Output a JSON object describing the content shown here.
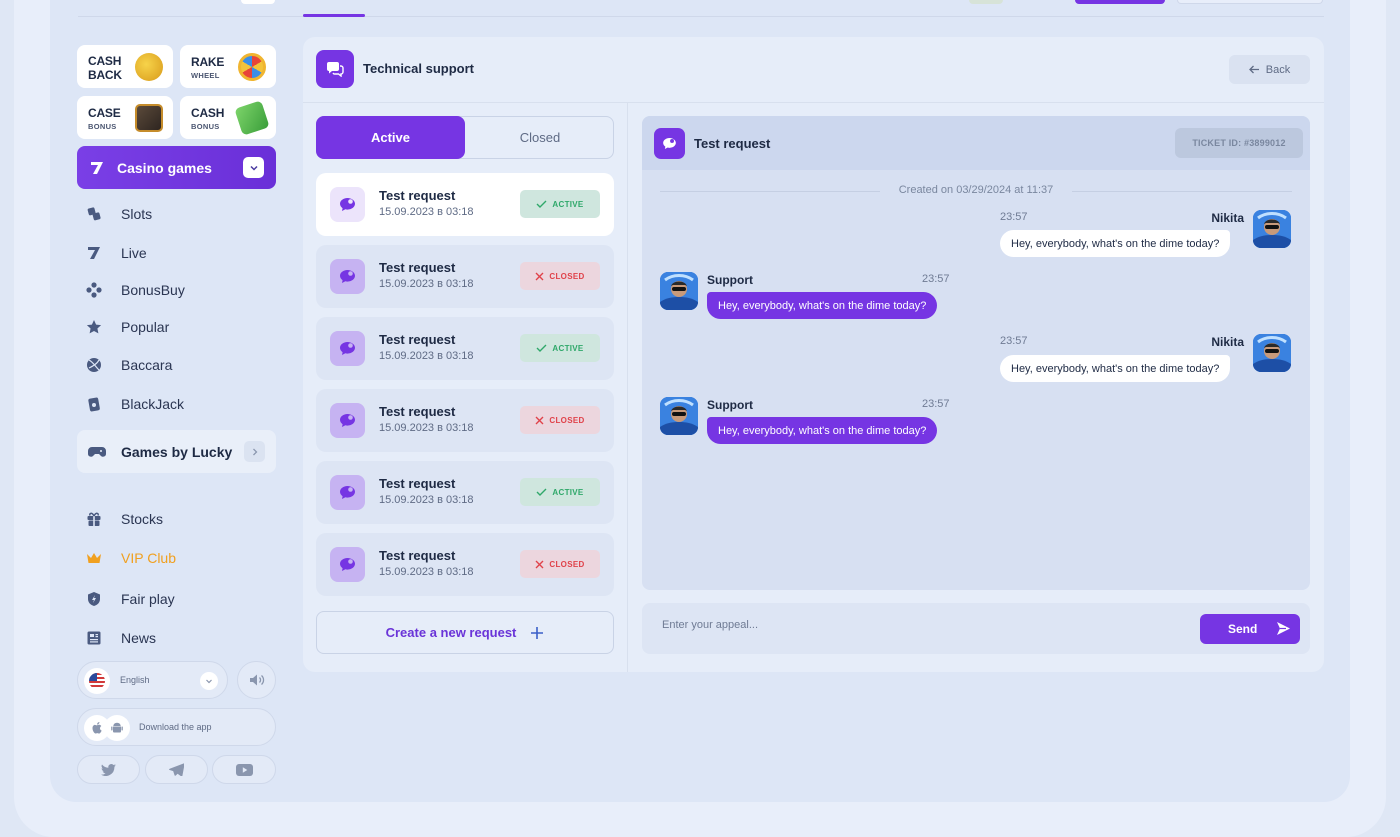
{
  "sidebar": {
    "promos": [
      {
        "title": "CASH",
        "sub": "BACK",
        "icon": "cashback-coin-icon"
      },
      {
        "title": "RAKE",
        "sub": "WHEEL",
        "icon": "wheel-icon"
      },
      {
        "title": "CASE",
        "sub": "BONUS",
        "icon": "safe-icon"
      },
      {
        "title": "CASH",
        "sub": "BONUS",
        "icon": "money-icon"
      }
    ],
    "casino_label": "Casino games",
    "games": [
      {
        "label": "Slots",
        "icon": "slots-icon"
      },
      {
        "label": "Live",
        "icon": "seven-icon"
      },
      {
        "label": "BonusBuy",
        "icon": "dpad-icon"
      },
      {
        "label": "Popular",
        "icon": "star-icon"
      },
      {
        "label": "Baccara",
        "icon": "ball-icon"
      },
      {
        "label": "BlackJack",
        "icon": "cards-icon"
      }
    ],
    "games_by_lucky": "Games by Lucky",
    "links": [
      {
        "label": "Stocks",
        "icon": "gift-icon"
      },
      {
        "label": "VIP Club",
        "icon": "crown-icon"
      },
      {
        "label": "Fair play",
        "icon": "shield-icon"
      },
      {
        "label": "News",
        "icon": "newspaper-icon"
      }
    ],
    "language": "English",
    "download": "Download the app"
  },
  "support": {
    "title": "Technical support",
    "back": "Back",
    "tabs": {
      "active": "Active",
      "closed": "Closed"
    },
    "tickets": [
      {
        "title": "Test request",
        "date": "15.09.2023 в 03:18",
        "status": "ACTIVE"
      },
      {
        "title": "Test request",
        "date": "15.09.2023 в 03:18",
        "status": "CLOSED"
      },
      {
        "title": "Test request",
        "date": "15.09.2023 в 03:18",
        "status": "ACTIVE"
      },
      {
        "title": "Test request",
        "date": "15.09.2023 в 03:18",
        "status": "CLOSED"
      },
      {
        "title": "Test request",
        "date": "15.09.2023 в 03:18",
        "status": "ACTIVE"
      },
      {
        "title": "Test request",
        "date": "15.09.2023 в 03:18",
        "status": "CLOSED"
      }
    ],
    "create": "Create a new request"
  },
  "chat": {
    "title": "Test request",
    "ticket_id": "TICKET ID: #3899012",
    "created": "Created on 03/29/2024 at 11:37",
    "messages": [
      {
        "author": "Nikita",
        "time": "23:57",
        "text": "Hey, everybody, what's on the dime today?"
      },
      {
        "author": "Support",
        "time": "23:57",
        "text": "Hey, everybody, what's on the dime today?"
      },
      {
        "author": "Nikita",
        "time": "23:57",
        "text": "Hey, everybody, what's on the dime today?"
      },
      {
        "author": "Support",
        "time": "23:57",
        "text": "Hey, everybody, what's on the dime today?"
      }
    ],
    "placeholder": "Enter your appeal...",
    "send": "Send"
  },
  "colors": {
    "accent": "#7635e3",
    "active": "#2fa86a",
    "closed": "#e0424a",
    "vip": "#f0a020"
  }
}
